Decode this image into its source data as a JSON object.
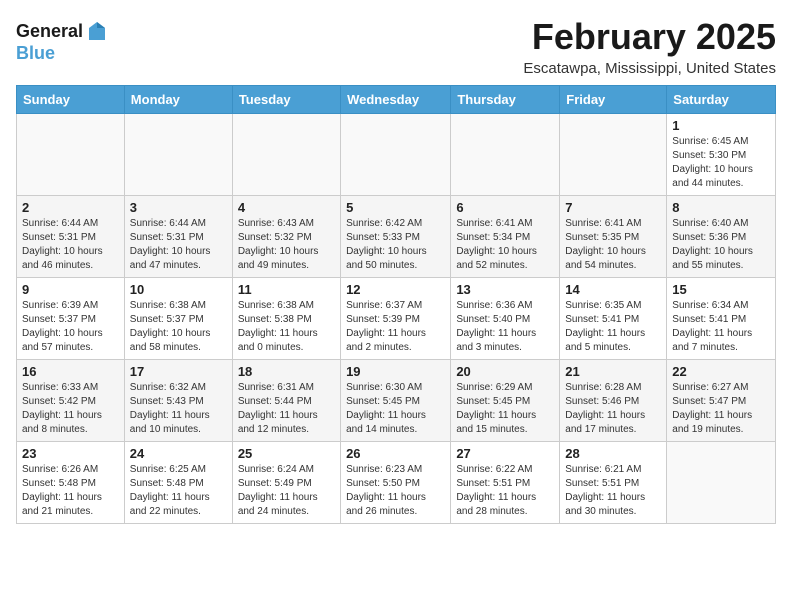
{
  "header": {
    "logo_line1": "General",
    "logo_line2": "Blue",
    "title": "February 2025",
    "location": "Escatawpa, Mississippi, United States"
  },
  "days_of_week": [
    "Sunday",
    "Monday",
    "Tuesday",
    "Wednesday",
    "Thursday",
    "Friday",
    "Saturday"
  ],
  "weeks": [
    [
      {
        "day": null
      },
      {
        "day": null
      },
      {
        "day": null
      },
      {
        "day": null
      },
      {
        "day": null
      },
      {
        "day": null
      },
      {
        "day": 1,
        "sunrise": "Sunrise: 6:45 AM",
        "sunset": "Sunset: 5:30 PM",
        "daylight": "Daylight: 10 hours and 44 minutes."
      }
    ],
    [
      {
        "day": 2,
        "sunrise": "Sunrise: 6:44 AM",
        "sunset": "Sunset: 5:31 PM",
        "daylight": "Daylight: 10 hours and 46 minutes."
      },
      {
        "day": 3,
        "sunrise": "Sunrise: 6:44 AM",
        "sunset": "Sunset: 5:31 PM",
        "daylight": "Daylight: 10 hours and 47 minutes."
      },
      {
        "day": 4,
        "sunrise": "Sunrise: 6:43 AM",
        "sunset": "Sunset: 5:32 PM",
        "daylight": "Daylight: 10 hours and 49 minutes."
      },
      {
        "day": 5,
        "sunrise": "Sunrise: 6:42 AM",
        "sunset": "Sunset: 5:33 PM",
        "daylight": "Daylight: 10 hours and 50 minutes."
      },
      {
        "day": 6,
        "sunrise": "Sunrise: 6:41 AM",
        "sunset": "Sunset: 5:34 PM",
        "daylight": "Daylight: 10 hours and 52 minutes."
      },
      {
        "day": 7,
        "sunrise": "Sunrise: 6:41 AM",
        "sunset": "Sunset: 5:35 PM",
        "daylight": "Daylight: 10 hours and 54 minutes."
      },
      {
        "day": 8,
        "sunrise": "Sunrise: 6:40 AM",
        "sunset": "Sunset: 5:36 PM",
        "daylight": "Daylight: 10 hours and 55 minutes."
      }
    ],
    [
      {
        "day": 9,
        "sunrise": "Sunrise: 6:39 AM",
        "sunset": "Sunset: 5:37 PM",
        "daylight": "Daylight: 10 hours and 57 minutes."
      },
      {
        "day": 10,
        "sunrise": "Sunrise: 6:38 AM",
        "sunset": "Sunset: 5:37 PM",
        "daylight": "Daylight: 10 hours and 58 minutes."
      },
      {
        "day": 11,
        "sunrise": "Sunrise: 6:38 AM",
        "sunset": "Sunset: 5:38 PM",
        "daylight": "Daylight: 11 hours and 0 minutes."
      },
      {
        "day": 12,
        "sunrise": "Sunrise: 6:37 AM",
        "sunset": "Sunset: 5:39 PM",
        "daylight": "Daylight: 11 hours and 2 minutes."
      },
      {
        "day": 13,
        "sunrise": "Sunrise: 6:36 AM",
        "sunset": "Sunset: 5:40 PM",
        "daylight": "Daylight: 11 hours and 3 minutes."
      },
      {
        "day": 14,
        "sunrise": "Sunrise: 6:35 AM",
        "sunset": "Sunset: 5:41 PM",
        "daylight": "Daylight: 11 hours and 5 minutes."
      },
      {
        "day": 15,
        "sunrise": "Sunrise: 6:34 AM",
        "sunset": "Sunset: 5:41 PM",
        "daylight": "Daylight: 11 hours and 7 minutes."
      }
    ],
    [
      {
        "day": 16,
        "sunrise": "Sunrise: 6:33 AM",
        "sunset": "Sunset: 5:42 PM",
        "daylight": "Daylight: 11 hours and 8 minutes."
      },
      {
        "day": 17,
        "sunrise": "Sunrise: 6:32 AM",
        "sunset": "Sunset: 5:43 PM",
        "daylight": "Daylight: 11 hours and 10 minutes."
      },
      {
        "day": 18,
        "sunrise": "Sunrise: 6:31 AM",
        "sunset": "Sunset: 5:44 PM",
        "daylight": "Daylight: 11 hours and 12 minutes."
      },
      {
        "day": 19,
        "sunrise": "Sunrise: 6:30 AM",
        "sunset": "Sunset: 5:45 PM",
        "daylight": "Daylight: 11 hours and 14 minutes."
      },
      {
        "day": 20,
        "sunrise": "Sunrise: 6:29 AM",
        "sunset": "Sunset: 5:45 PM",
        "daylight": "Daylight: 11 hours and 15 minutes."
      },
      {
        "day": 21,
        "sunrise": "Sunrise: 6:28 AM",
        "sunset": "Sunset: 5:46 PM",
        "daylight": "Daylight: 11 hours and 17 minutes."
      },
      {
        "day": 22,
        "sunrise": "Sunrise: 6:27 AM",
        "sunset": "Sunset: 5:47 PM",
        "daylight": "Daylight: 11 hours and 19 minutes."
      }
    ],
    [
      {
        "day": 23,
        "sunrise": "Sunrise: 6:26 AM",
        "sunset": "Sunset: 5:48 PM",
        "daylight": "Daylight: 11 hours and 21 minutes."
      },
      {
        "day": 24,
        "sunrise": "Sunrise: 6:25 AM",
        "sunset": "Sunset: 5:48 PM",
        "daylight": "Daylight: 11 hours and 22 minutes."
      },
      {
        "day": 25,
        "sunrise": "Sunrise: 6:24 AM",
        "sunset": "Sunset: 5:49 PM",
        "daylight": "Daylight: 11 hours and 24 minutes."
      },
      {
        "day": 26,
        "sunrise": "Sunrise: 6:23 AM",
        "sunset": "Sunset: 5:50 PM",
        "daylight": "Daylight: 11 hours and 26 minutes."
      },
      {
        "day": 27,
        "sunrise": "Sunrise: 6:22 AM",
        "sunset": "Sunset: 5:51 PM",
        "daylight": "Daylight: 11 hours and 28 minutes."
      },
      {
        "day": 28,
        "sunrise": "Sunrise: 6:21 AM",
        "sunset": "Sunset: 5:51 PM",
        "daylight": "Daylight: 11 hours and 30 minutes."
      },
      {
        "day": null
      }
    ]
  ]
}
